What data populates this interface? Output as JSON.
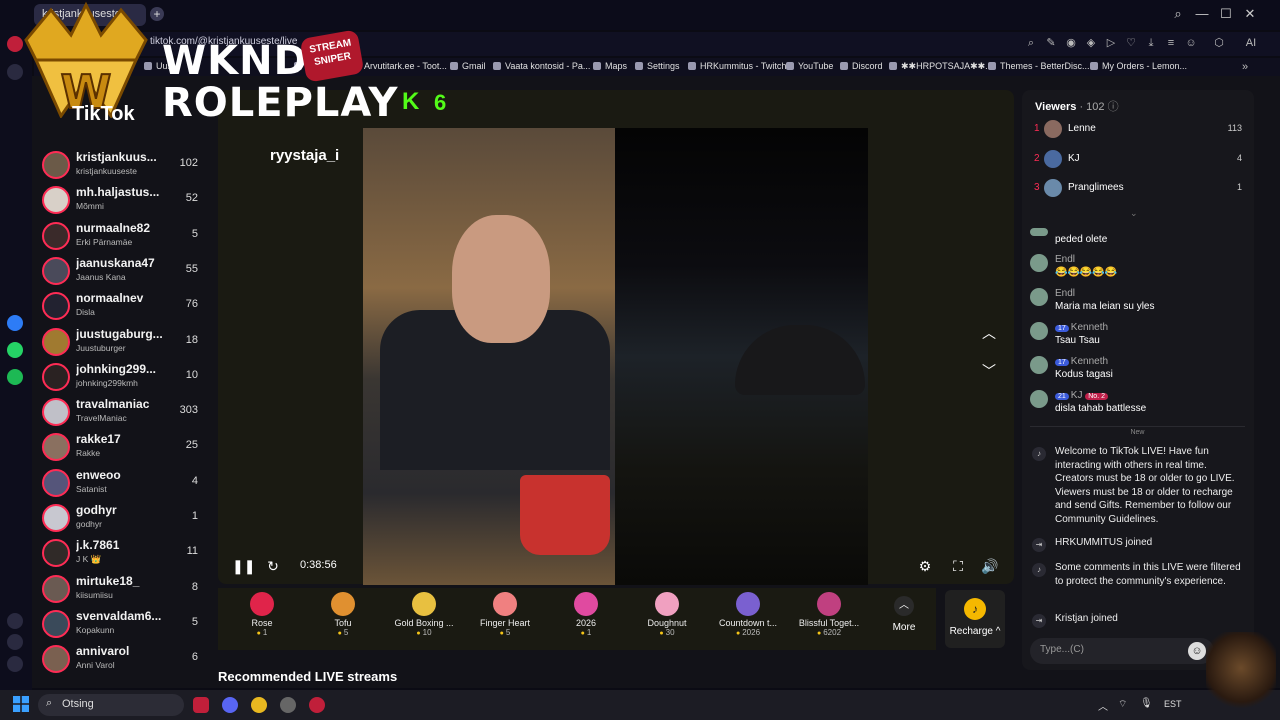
{
  "browser": {
    "tab_title": "kristjankuuseste",
    "url": "tiktok.com/@kristjankuuseste/live",
    "bookmarks": [
      "Uus",
      "Uus",
      "Arvutitark.ee - Toot...",
      "Gmail",
      "Vaata kontosid - Pa...",
      "Maps",
      "Settings",
      "HRKummitus - Twitch",
      "YouTube",
      "Discord",
      "✱✱HRPOTSAJA✱✱...",
      "Themes - BetterDisc...",
      "My Orders - Lemon..."
    ]
  },
  "overlay": {
    "line1": "WKND",
    "line2": "ROLEPLAY",
    "sniper": "STREAM SNIPER",
    "kick_count": "6",
    "tiktok_header": "TikTok"
  },
  "following": [
    {
      "name": "kristjankuus...",
      "sub": "kristjankuuseste",
      "count": "102",
      "color": "#6b5a48"
    },
    {
      "name": "mh.haljastus...",
      "sub": "Mõmmi",
      "count": "52",
      "color": "#d8d0c8"
    },
    {
      "name": "nurmaalne82",
      "sub": "Erki Pärnamäe",
      "count": "5",
      "color": "#3a2a2a"
    },
    {
      "name": "jaanuskana47",
      "sub": "Jaanus Kana",
      "count": "55",
      "color": "#4a4a5a"
    },
    {
      "name": "normaalnev",
      "sub": "Disla",
      "count": "76",
      "color": "#222230"
    },
    {
      "name": "juustugaburg...",
      "sub": "Juustuburger",
      "count": "18",
      "color": "#a07a30"
    },
    {
      "name": "johnking299...",
      "sub": "johnking299kmh",
      "count": "10",
      "color": "#2a2222"
    },
    {
      "name": "travalmaniac",
      "sub": "TravelManiac",
      "count": "303",
      "color": "#c0c0c8"
    },
    {
      "name": "rakke17",
      "sub": "Rakke",
      "count": "25",
      "color": "#8a7060"
    },
    {
      "name": "enweoo",
      "sub": "Satanist",
      "count": "4",
      "color": "#55557a"
    },
    {
      "name": "godhyr",
      "sub": "godhyr",
      "count": "1",
      "color": "#c8c8d0"
    },
    {
      "name": "j.k.7861",
      "sub": "J K 👑",
      "count": "11",
      "color": "#302a28"
    },
    {
      "name": "mirtuke18_",
      "sub": "kiisumiisu",
      "count": "8",
      "color": "#6a5a52"
    },
    {
      "name": "svenvaldam6...",
      "sub": "Kopakunn",
      "count": "5",
      "color": "#3a4a5a"
    },
    {
      "name": "annivarol",
      "sub": "Anni Varol",
      "count": "6",
      "color": "#7a6050"
    }
  ],
  "player": {
    "streamer": "ryystaja_i",
    "elapsed": "0:38:56",
    "pause_icon": "pause-icon",
    "refresh_icon": "refresh-icon"
  },
  "gifts": [
    {
      "name": "Rose",
      "price": "1",
      "color": "#e0244a"
    },
    {
      "name": "Tofu",
      "price": "5",
      "color": "#e09030"
    },
    {
      "name": "Gold Boxing ...",
      "price": "10",
      "color": "#e8c040"
    },
    {
      "name": "Finger Heart",
      "price": "5",
      "color": "#f08080"
    },
    {
      "name": "2026",
      "price": "1",
      "color": "#e04aa0"
    },
    {
      "name": "Doughnut",
      "price": "30",
      "color": "#f0a0c0"
    },
    {
      "name": "Countdown t...",
      "price": "2026",
      "color": "#7a60d0"
    },
    {
      "name": "Blissful Toget...",
      "price": "6202",
      "color": "#c04080"
    }
  ],
  "gift_more": "More",
  "recharge": "Recharge",
  "recommended_title": "Recommended LIVE streams",
  "viewers": {
    "title": "Viewers",
    "count": "· 102",
    "top": [
      {
        "rank": "1",
        "name": "Lenne",
        "count": "113"
      },
      {
        "rank": "2",
        "name": "KJ",
        "count": "4"
      },
      {
        "rank": "3",
        "name": "Pranglimees",
        "count": "1"
      }
    ]
  },
  "chat": [
    {
      "name": "",
      "text": "peded olete"
    },
    {
      "name": "Endl",
      "text": "😂😂😂😂😂"
    },
    {
      "name": "Endl",
      "text": "Maria ma leian su yles"
    },
    {
      "name": "Kenneth",
      "badge": "17",
      "text": "Tsau Tsau"
    },
    {
      "name": "Kenneth",
      "badge": "17",
      "text": "Kodus tagasi"
    },
    {
      "name": "KJ",
      "badge": "21",
      "text": "disla tahab battlesse",
      "extra": "No. 2"
    }
  ],
  "new_divider": "New",
  "system_msgs": [
    "Welcome to TikTok LIVE! Have fun interacting with others in real time. Creators must be 18 or older to go LIVE. Viewers must be 18 or older to recharge and send Gifts. Remember to follow our Community Guidelines.",
    "HRKUMMITUS joined",
    "Some comments in this LIVE were filtered to protect the community's experience.",
    "Kristjan joined"
  ],
  "chat_input_placeholder": "Type...(C)",
  "taskbar": {
    "search": "Otsing",
    "lang": "EST"
  }
}
